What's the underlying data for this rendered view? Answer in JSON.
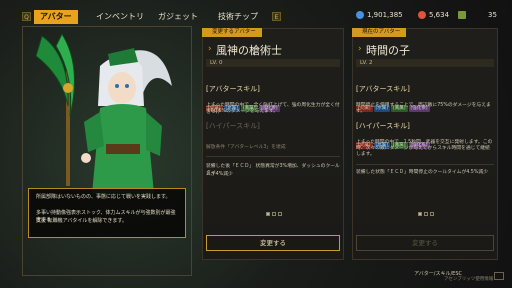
{
  "tabs": [
    {
      "label": "アバター",
      "active": true
    },
    {
      "label": "インベントリ",
      "active": false
    },
    {
      "label": "ガジェット",
      "active": false
    },
    {
      "label": "技術チップ",
      "active": false
    }
  ],
  "keys": {
    "left": "Q",
    "right": "E"
  },
  "currencies": [
    {
      "icon": "coin-icon",
      "value": "1,901,385",
      "color": "#4a8fe0"
    },
    {
      "icon": "gem-icon",
      "value": "5,634",
      "color": "#e0533c"
    },
    {
      "icon": "key-icon",
      "value": "35",
      "color": "#7a9a3a"
    }
  ],
  "avatar_description": [
    "所属部隊はいないものの、事態に応じて戦いを実践します。",
    "多事い持動像強表示ストック、体力ムスキルが与強数別が最強度する",
    "支援 転職機アバタイルを解除できます。"
  ],
  "left_panel": {
    "tag": "変更するアバター",
    "title": "風神の槍術士",
    "level": "LV. 0",
    "avatar_skill_header": "[アバタースキル]",
    "avatar_skill_tags": [
      "[火属]",
      "[水属]",
      "[風属]",
      "[強化系]"
    ],
    "avatar_skill_text": [
      "上まった時間の中で、全く強打上げて、強の周化生力が全く付きつけ",
      "て60.5%のダメージを与えます。"
    ],
    "hyper_skill_header": "[ハイパースキル]",
    "hyper_skill_text": "解放条件「アバターレベル3」を達成",
    "extra_text": [
      "装備した後「ＥＣＤ」 状態異常が3%増加、ダッシュのクールタイ",
      "ムが4%減少"
    ],
    "button": "変更する"
  },
  "right_panel": {
    "tag": "現在のアバター",
    "title": "時間の子",
    "level": "LV. 2",
    "avatar_skill_header": "[アバタースキル]",
    "avatar_skill_tags": [
      "[火属]",
      "[水属]",
      "[風属]",
      "[強化系]"
    ],
    "avatar_skill_text": [
      "時間停止を使用することで、周辺敵に75%のダメージを与えま",
      "す。"
    ],
    "hyper_skill_header": "[ハイパースキル]",
    "hyper_skill_tags": [
      "[火属]",
      "[水属]",
      "[風属]",
      "[強化系]"
    ],
    "hyper_skill_text": [
      "上まった時間の中で、1.5秒間、武器を交互に発射します。この",
      "時、次々の敵にダメージが与えてからスキル時間を通じて継続",
      "します。"
    ],
    "extra_text": "装備した状態「ＥＣＤ」時間停止のクールタイムが4.5%減少",
    "button": "変更する"
  },
  "footer": {
    "hint": "アバター/スキル/ESC",
    "note": "アセンブリッツ使用情報"
  }
}
